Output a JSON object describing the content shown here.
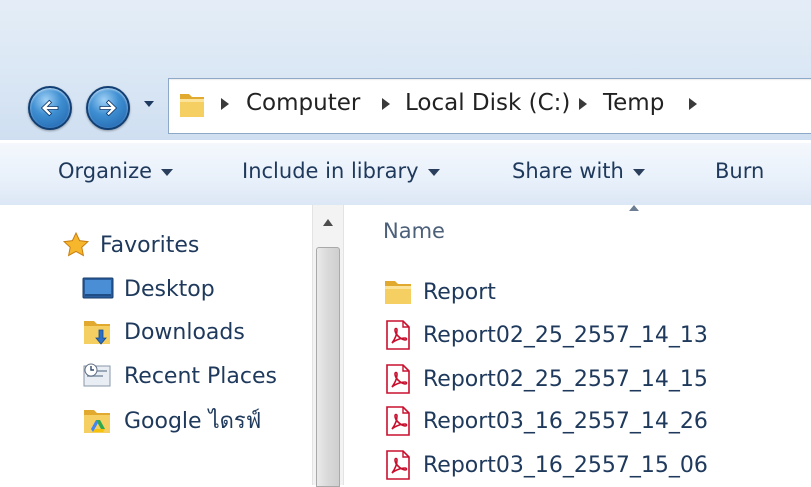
{
  "address_bar": {
    "breadcrumbs": [
      "Computer",
      "Local Disk (C:)",
      "Temp"
    ]
  },
  "toolbar": {
    "organize_label": "Organize",
    "include_label": "Include in library",
    "share_label": "Share with",
    "burn_label": "Burn"
  },
  "nav_pane": {
    "favorites_label": "Favorites",
    "items": [
      {
        "label": "Desktop",
        "icon": "desktop-icon"
      },
      {
        "label": "Downloads",
        "icon": "downloads-folder-icon"
      },
      {
        "label": "Recent Places",
        "icon": "recent-places-icon"
      },
      {
        "label": "Google ไดรฟ์",
        "icon": "google-drive-folder-icon"
      }
    ]
  },
  "file_list": {
    "column_header": "Name",
    "files": [
      {
        "name": "Report",
        "type": "folder"
      },
      {
        "name": "Report02_25_2557_14_13",
        "type": "pdf"
      },
      {
        "name": "Report02_25_2557_14_15",
        "type": "pdf"
      },
      {
        "name": "Report03_16_2557_14_26",
        "type": "pdf"
      },
      {
        "name": "Report03_16_2557_15_06",
        "type": "pdf"
      }
    ]
  },
  "colors": {
    "text": "#1e395b",
    "pdf_icon": "#c8102e",
    "folder": "#f2c14e",
    "nav_button": "#2f7fc8"
  }
}
